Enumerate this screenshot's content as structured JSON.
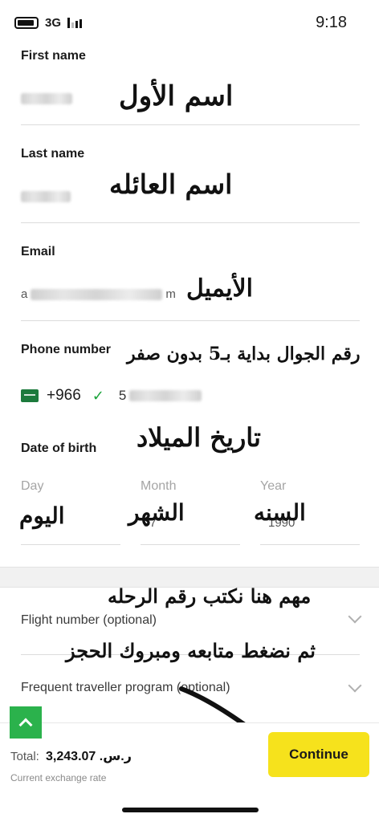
{
  "status_bar": {
    "network": "3G",
    "time": "9:18"
  },
  "form": {
    "first_name": {
      "label": "First name",
      "value_hint": "Ahmed"
    },
    "last_name": {
      "label": "Last name"
    },
    "email": {
      "label": "Email",
      "value_start": "a",
      "value_end": "m"
    },
    "phone": {
      "label": "Phone number",
      "country_code": "+966",
      "number_start": "5"
    },
    "dob": {
      "label": "Date of birth",
      "day_label": "Day",
      "month_label": "Month",
      "year_label": "Year",
      "month_value": "07",
      "year_value": "1990"
    },
    "flight_number": {
      "label": "Flight number (optional)"
    },
    "frequent_traveller": {
      "label": "Frequent traveller program (optional)"
    }
  },
  "annotations": {
    "first_name": "اسم الأول",
    "last_name": "اسم العائله",
    "email": "الأيميل",
    "phone": "رقم الجوال بداية بـ5 بدون صفر",
    "dob": "تاريخ الميلاد",
    "day": "اليوم",
    "month": "الشهر",
    "year": "السنه",
    "flight_note": "مهم هنا نكتب رقم الرحله",
    "continue_note": "ثم نضغط متابعه ومبروك الحجز"
  },
  "footer": {
    "total_label": "Total:",
    "total_value": "3,243.07 .ر.س",
    "rate_label": "Current exchange rate",
    "continue_label": "Continue"
  },
  "colors": {
    "continue_button": "#f6e21c",
    "up_button": "#2bb24c",
    "check": "#1aa33a"
  },
  "icons": [
    "battery-icon",
    "signal-icon",
    "saudi-flag-icon",
    "check-icon",
    "chevron-down-icon",
    "chevron-up-icon"
  ]
}
